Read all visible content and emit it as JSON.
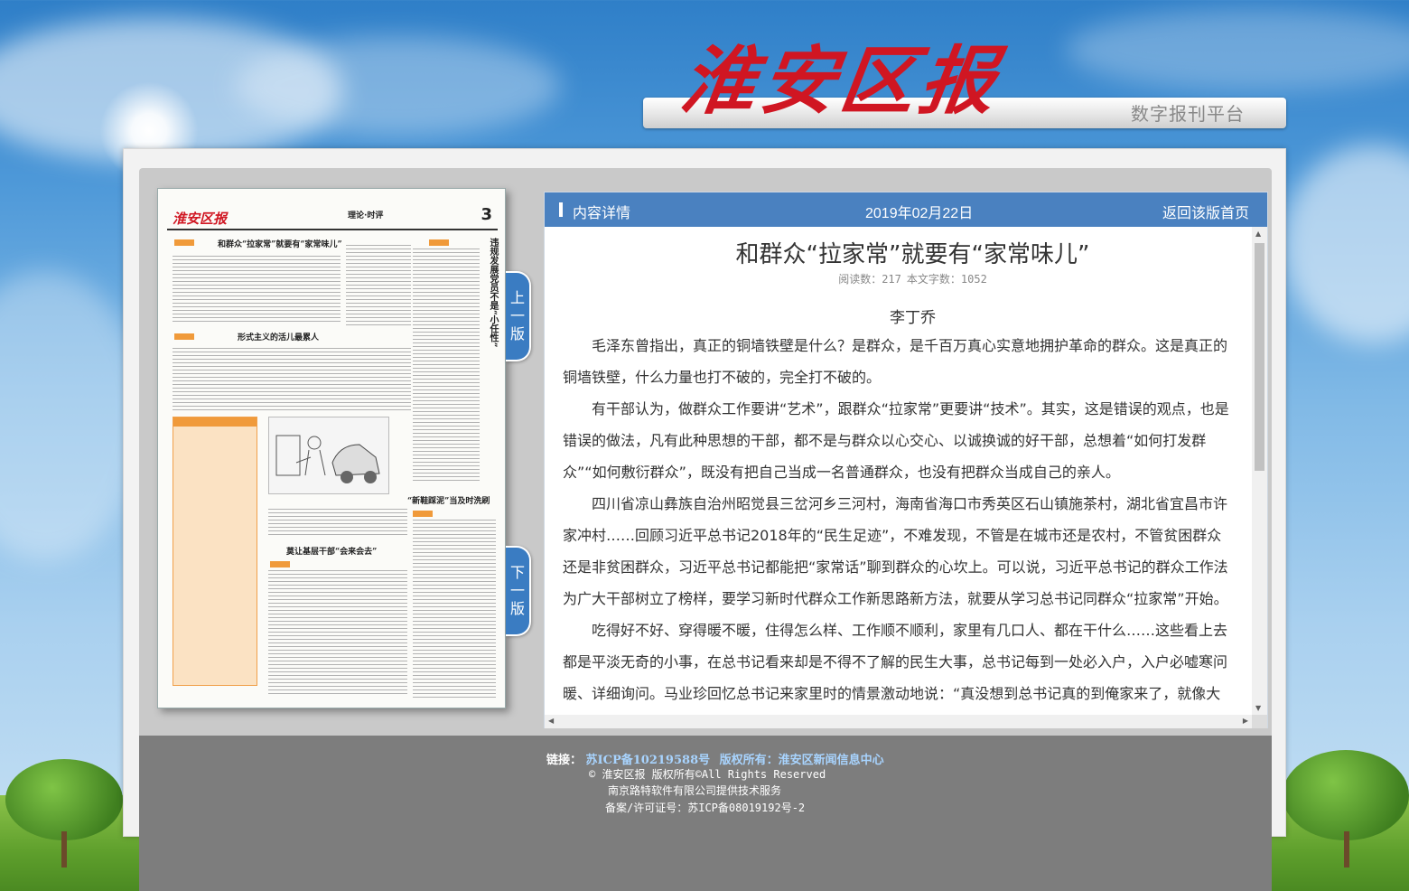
{
  "masthead": {
    "logo_text": "淮安区报",
    "subtitle": "数字报刊平台"
  },
  "paper": {
    "logo": "淮安区报",
    "section": "理论·时评",
    "page_number": "3",
    "headlines": [
      "和群众“拉家常”就要有“家常味儿”",
      "形式主义的活儿最累人",
      "“新鞋踩泥”当及时洗刷",
      "莫让基层干部“会来会去”"
    ],
    "vertical_headline": "违规发展党员不是“小任性”"
  },
  "nav": {
    "prev_label": [
      "上",
      "一",
      "版"
    ],
    "next_label": [
      "下",
      "一",
      "版"
    ]
  },
  "article_bar": {
    "title": "内容详情",
    "date": "2019年02月22日",
    "back_link": "返回该版首页"
  },
  "article": {
    "title": "和群众“拉家常”就要有“家常味儿”",
    "read_count": "阅读数：217",
    "word_count": "本文字数：1052",
    "author": "李丁乔",
    "paragraphs": [
      "毛泽东曾指出，真正的铜墙铁壁是什么？是群众，是千百万真心实意地拥护革命的群众。这是真正的铜墙铁壁，什么力量也打不破的，完全打不破的。",
      "有干部认为，做群众工作要讲“艺术”，跟群众“拉家常”更要讲“技术”。其实，这是错误的观点，也是错误的做法，凡有此种思想的干部，都不是与群众以心交心、以诚换诚的好干部，总想着“如何打发群众”“如何敷衍群众”，既没有把自己当成一名普通群众，也没有把群众当成自己的亲人。",
      "四川省凉山彝族自治州昭觉县三岔河乡三河村，海南省海口市秀英区石山镇施茶村，湖北省宜昌市许家冲村……回顾习近平总书记2018年的“民生足迹”，不难发现，不管是在城市还是农村，不管贫困群众还是非贫困群众，习近平总书记都能把“家常话”聊到群众的心坎上。可以说，习近平总书记的群众工作法为广大干部树立了榜样，要学习新时代群众工作新思路新方法，就要从学习总书记同群众“拉家常”开始。",
      "吃得好不好、穿得暖不暖，住得怎么样、工作顺不顺利，家里有几口人、都在干什么……这些看上去都是平淡无奇的小事，在总书记看来却是不得不了解的民生大事，总书记每到一处必入户，入户必嘘寒问暖、详细询问。马业珍回忆总书记来家里时的情景激动地说：“真没想到总书记真的到俺家来了，就像大"
    ]
  },
  "footer": {
    "links_label": "链接：",
    "icp_link": "苏ICP备10219588号",
    "copyright_link": "版权所有：淮安区新闻信息中心",
    "line2": "© 淮安区报 版权所有©All Rights Reserved",
    "line3": "南京路特软件有限公司提供技术服务",
    "line4": "备案/许可证号：苏ICP备08019192号-2"
  }
}
